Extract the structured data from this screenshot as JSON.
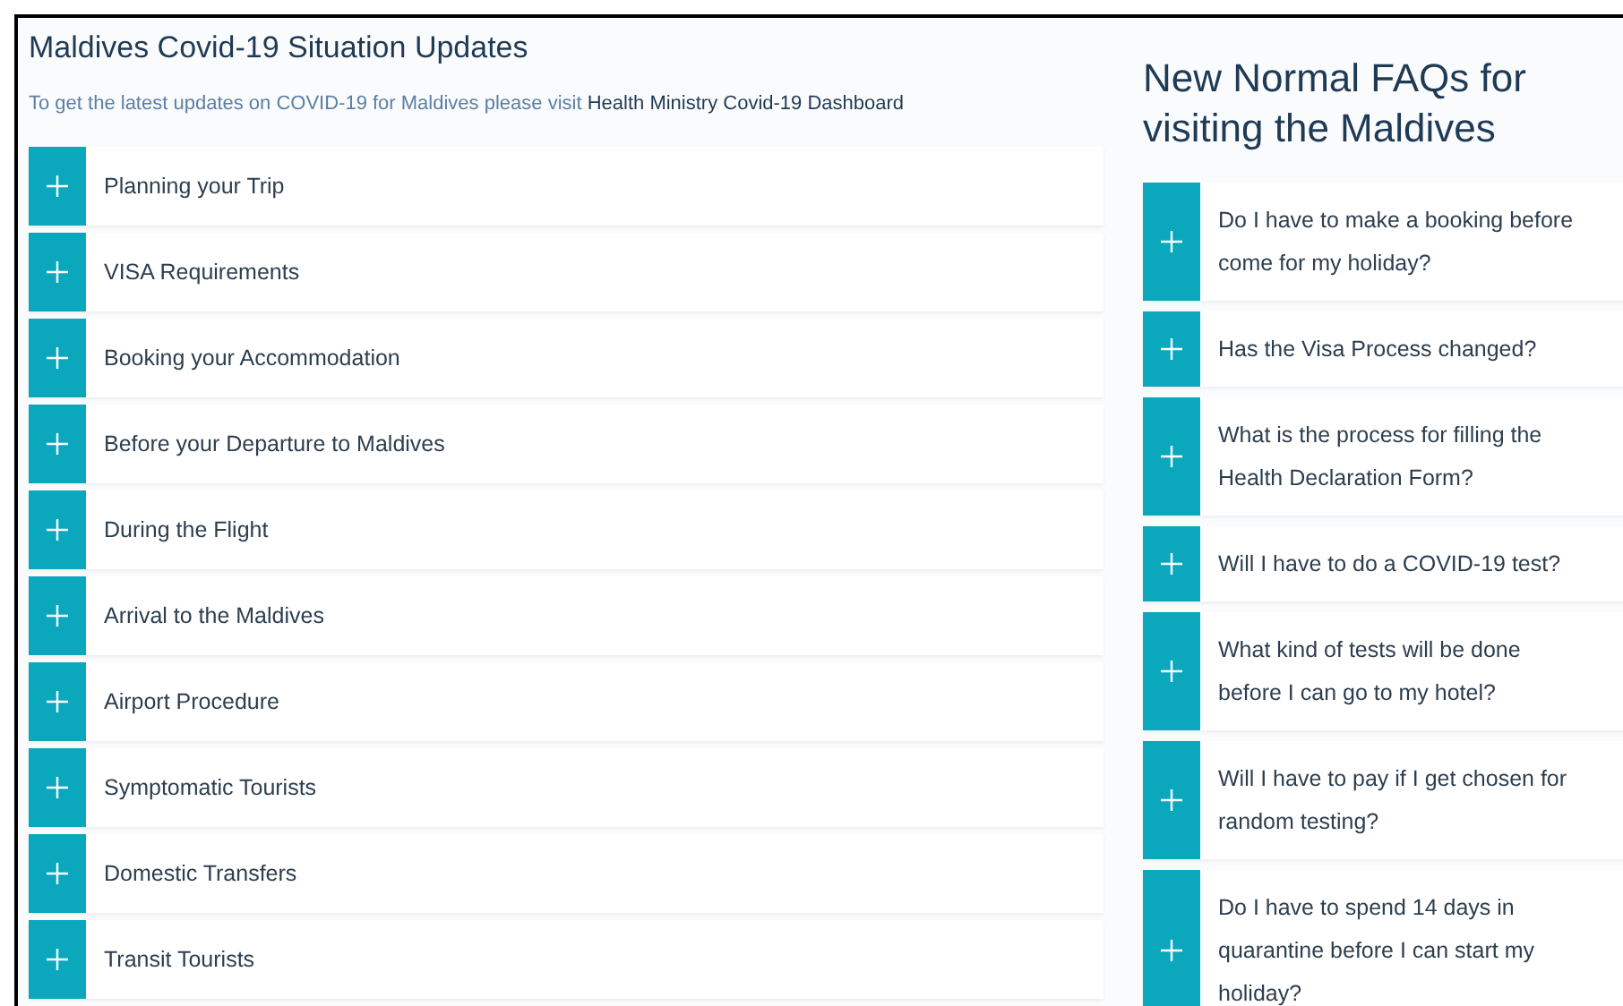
{
  "updates": {
    "title": "Maldives Covid-19 Situation Updates",
    "intro": "To get the latest updates on COVID-19 for Maldives please visit",
    "link": "Health Ministry Covid-19 Dashboard",
    "items": [
      {
        "label": "Planning your Trip",
        "expanded": false
      },
      {
        "label": "VISA Requirements",
        "expanded": false
      },
      {
        "label": "Booking your Accommodation",
        "expanded": false
      },
      {
        "label": "Before your Departure to Maldives",
        "expanded": false
      },
      {
        "label": "During the Flight",
        "expanded": false
      },
      {
        "label": "Arrival to the Maldives",
        "expanded": false
      },
      {
        "label": "Airport Procedure",
        "expanded": false
      },
      {
        "label": "Symptomatic Tourists",
        "expanded": false
      },
      {
        "label": "Domestic Transfers",
        "expanded": false
      },
      {
        "label": "Transit Tourists",
        "expanded": false
      }
    ]
  },
  "faqs": {
    "title": "New Normal FAQs for visiting the Maldives",
    "items": [
      {
        "lines": [
          "Do I have to make a booking before",
          "come for my holiday?"
        ],
        "expanded": false
      },
      {
        "lines": [
          "Has the Visa Process changed?"
        ],
        "expanded": false
      },
      {
        "lines": [
          "What is the process for filling the",
          "Health Declaration Form?"
        ],
        "expanded": false
      },
      {
        "lines": [
          "Will I have to do a COVID-19 test?"
        ],
        "expanded": false
      },
      {
        "lines": [
          "What kind of tests will be done",
          "before I can go to my hotel?"
        ],
        "expanded": false
      },
      {
        "lines": [
          "Will I have to pay if I get chosen for",
          "random testing?"
        ],
        "expanded": false
      },
      {
        "lines": [
          "Do I have to spend 14 days in",
          "quarantine before I can start my",
          "holiday?"
        ],
        "expanded": false
      }
    ]
  }
}
